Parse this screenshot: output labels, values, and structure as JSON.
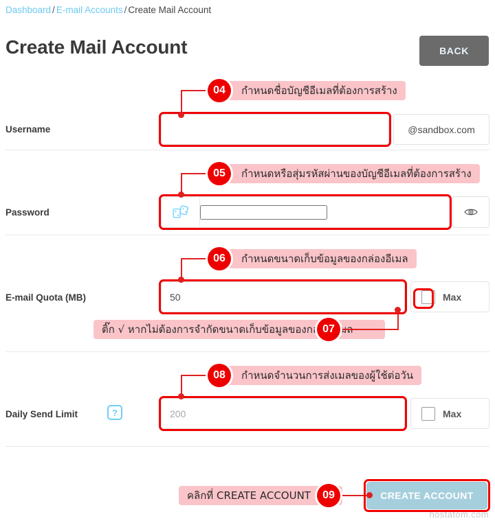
{
  "breadcrumb": {
    "items": [
      "Dashboard",
      "E-mail Accounts",
      "Create Mail Account"
    ],
    "separator": "/"
  },
  "header": {
    "title": "Create Mail Account",
    "back_label": "BACK"
  },
  "form": {
    "username": {
      "label": "Username",
      "value": "",
      "placeholder": "",
      "suffix": "@sandbox.com"
    },
    "password": {
      "label": "Password",
      "value": "",
      "placeholder": "",
      "dice_icon": "dice-icon",
      "eye_icon": "eye-icon"
    },
    "quota": {
      "label": "E-mail Quota (MB)",
      "value": "50",
      "placeholder": "",
      "max_label": "Max",
      "max_checked": false
    },
    "daily_send_limit": {
      "label": "Daily Send Limit",
      "value": "",
      "placeholder": "200",
      "help_icon": "question-mark-icon",
      "max_label": "Max",
      "max_checked": false
    },
    "submit_label": "CREATE ACCOUNT"
  },
  "annotations": [
    {
      "number": "04",
      "text": "กำหนดชื่อบัญชีอีเมลที่ต้องการสร้าง"
    },
    {
      "number": "05",
      "text": "กำหนดหรือสุ่มรหัสผ่านของบัญชีอีเมลที่ต้องการสร้าง"
    },
    {
      "number": "06",
      "text": "กำหนดขนาดเก็บข้อมูลของกล่องอีเมล"
    },
    {
      "number": "07",
      "text": "ติ๊ก √ หากไม่ต้องการจำกัดขนาดเก็บข้อมูลของกล่องอีเมล"
    },
    {
      "number": "08",
      "text": "กำหนดจำนวนการส่งเมลของผู้ใช้ต่อวัน"
    },
    {
      "number": "09",
      "text": "คลิกที่ CREATE ACCOUNT"
    }
  ],
  "watermark": "hostatom.com",
  "colors": {
    "link": "#6dc8f0",
    "annotation_red": "#ee0000",
    "callout_bg": "#fac4c9",
    "back_button": "#6b6b6b",
    "create_button": "#a6cfdd",
    "accent_blue": "#6ccff5"
  }
}
